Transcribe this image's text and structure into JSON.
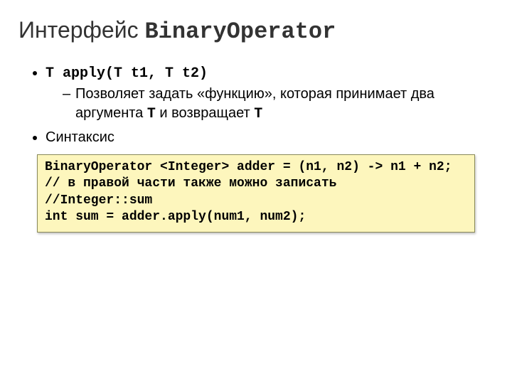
{
  "title": {
    "prefix": "Интерфейс ",
    "mono": "BinaryOperator"
  },
  "bullets": {
    "b1_mono": "T apply(T t1, T t2)",
    "b1_sub_pre": "Позволяет задать «функцию», которая принимает два аргумента ",
    "b1_sub_t1": "T",
    "b1_sub_mid": "  и возвращает ",
    "b1_sub_t2": "T",
    "b2": "Синтаксис"
  },
  "code": "BinaryOperator <Integer> adder = (n1, n2) -> n1 + n2;\n// в правой части также можно записать\n//Integer::sum\nint sum = adder.apply(num1, num2);"
}
